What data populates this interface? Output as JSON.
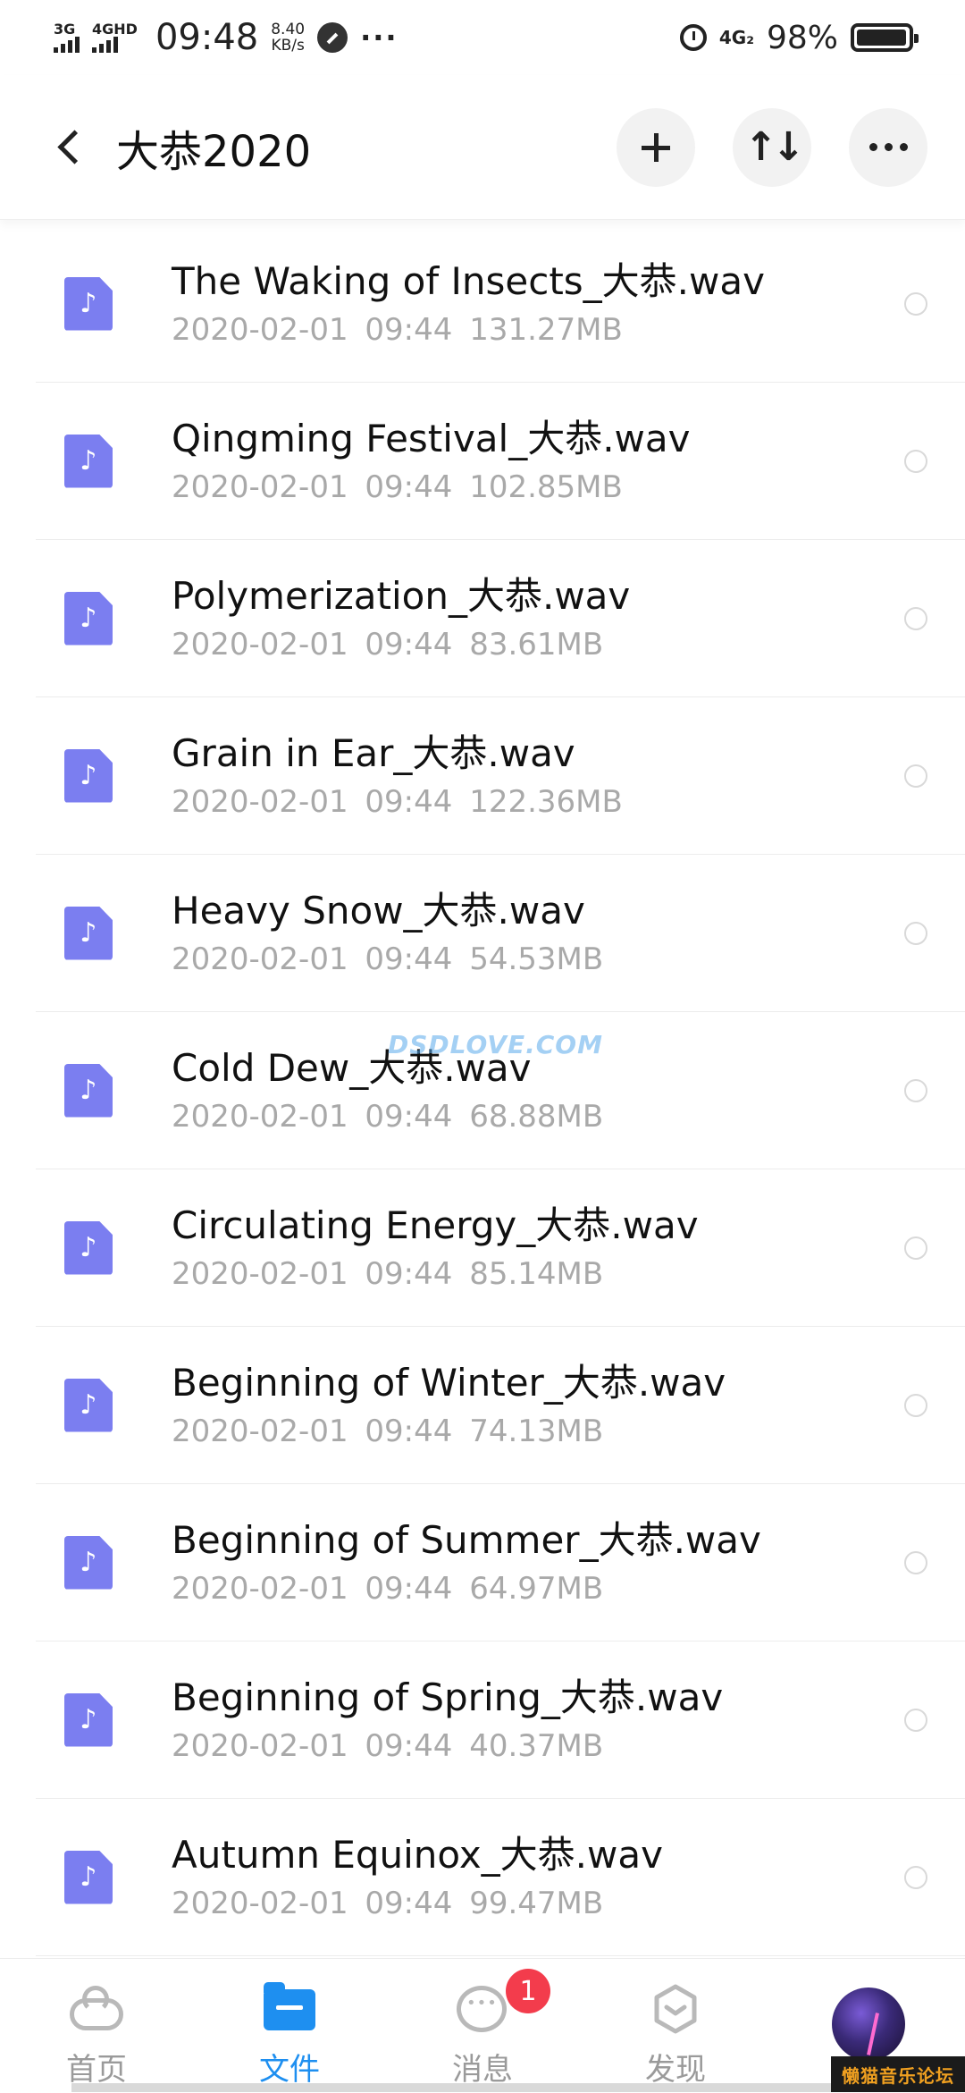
{
  "status_bar": {
    "net1": "3G",
    "net2": "4GHD",
    "time": "09:48",
    "speed_value": "8.40",
    "speed_unit": "KB/s",
    "more": "···",
    "network_right": "4G₂",
    "battery": "98%"
  },
  "header": {
    "title": "大恭2020",
    "back_icon": "chevron-left-icon",
    "add_icon": "plus-icon",
    "sort_icon": "sort-icon",
    "more_icon": "more-dots-icon"
  },
  "files": [
    {
      "name": "The Waking of Insects_大恭.wav",
      "date": "2020-02-01",
      "time": "09:44",
      "size": "131.27MB"
    },
    {
      "name": "Qingming Festival_大恭.wav",
      "date": "2020-02-01",
      "time": "09:44",
      "size": "102.85MB"
    },
    {
      "name": "Polymerization_大恭.wav",
      "date": "2020-02-01",
      "time": "09:44",
      "size": "83.61MB"
    },
    {
      "name": "Grain in Ear_大恭.wav",
      "date": "2020-02-01",
      "time": "09:44",
      "size": "122.36MB"
    },
    {
      "name": "Heavy Snow_大恭.wav",
      "date": "2020-02-01",
      "time": "09:44",
      "size": "54.53MB"
    },
    {
      "name": "Cold Dew_大恭.wav",
      "date": "2020-02-01",
      "time": "09:44",
      "size": "68.88MB"
    },
    {
      "name": "Circulating Energy_大恭.wav",
      "date": "2020-02-01",
      "time": "09:44",
      "size": "85.14MB"
    },
    {
      "name": "Beginning of Winter_大恭.wav",
      "date": "2020-02-01",
      "time": "09:44",
      "size": "74.13MB"
    },
    {
      "name": "Beginning of Summer_大恭.wav",
      "date": "2020-02-01",
      "time": "09:44",
      "size": "64.97MB"
    },
    {
      "name": "Beginning of Spring_大恭.wav",
      "date": "2020-02-01",
      "time": "09:44",
      "size": "40.37MB"
    },
    {
      "name": "Autumn Equinox_大恭.wav",
      "date": "2020-02-01",
      "time": "09:44",
      "size": "99.47MB"
    }
  ],
  "watermark": "DSDLOVE.COM",
  "bottom_nav": {
    "items": [
      {
        "label": "首页",
        "icon": "cloud-icon"
      },
      {
        "label": "文件",
        "icon": "folder-icon",
        "active": true
      },
      {
        "label": "消息",
        "icon": "chat-icon",
        "badge": "1"
      },
      {
        "label": "发现",
        "icon": "discover-icon"
      },
      {
        "label": "",
        "icon": "avatar"
      }
    ]
  },
  "corner_logo": "懒猫音乐论坛",
  "colors": {
    "accent": "#1e8ff0",
    "file_icon": "#7b7ef0",
    "badge": "#f33c4c"
  }
}
